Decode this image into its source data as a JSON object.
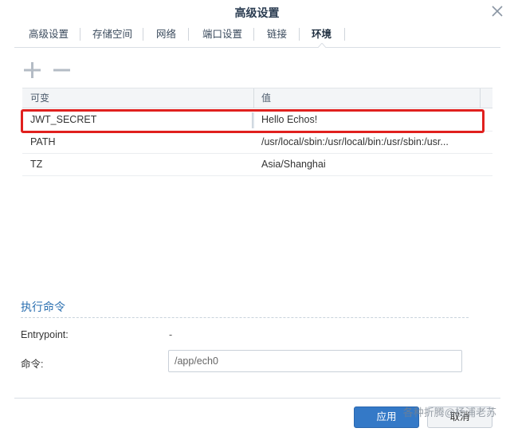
{
  "window": {
    "title": "高级设置"
  },
  "tabs": [
    {
      "label": "高级设置"
    },
    {
      "label": "存储空间"
    },
    {
      "label": "网络"
    },
    {
      "label": "端口设置"
    },
    {
      "label": "链接"
    },
    {
      "label": "环境",
      "active": true
    }
  ],
  "toolbar": {
    "add_icon": "plus-icon",
    "remove_icon": "minus-icon"
  },
  "env_table": {
    "columns": [
      "可变",
      "值"
    ],
    "rows": [
      {
        "name": "JWT_SECRET",
        "value": "Hello Echos!",
        "highlighted": true
      },
      {
        "name": "PATH",
        "value": "/usr/local/sbin:/usr/local/bin:/usr/sbin:/usr..."
      },
      {
        "name": "TZ",
        "value": "Asia/Shanghai"
      }
    ]
  },
  "exec_section": {
    "title": "执行命令",
    "entrypoint_label": "Entrypoint:",
    "entrypoint_value": "-",
    "command_label": "命令:",
    "command_value": "/app/ech0"
  },
  "footer": {
    "apply_label": "应用",
    "cancel_label": "取消"
  },
  "watermark": "各种折腾@杨浦老苏",
  "colors": {
    "accent": "#3479c7",
    "highlight_border": "#e0201e",
    "section_title": "#2a6fb0"
  }
}
